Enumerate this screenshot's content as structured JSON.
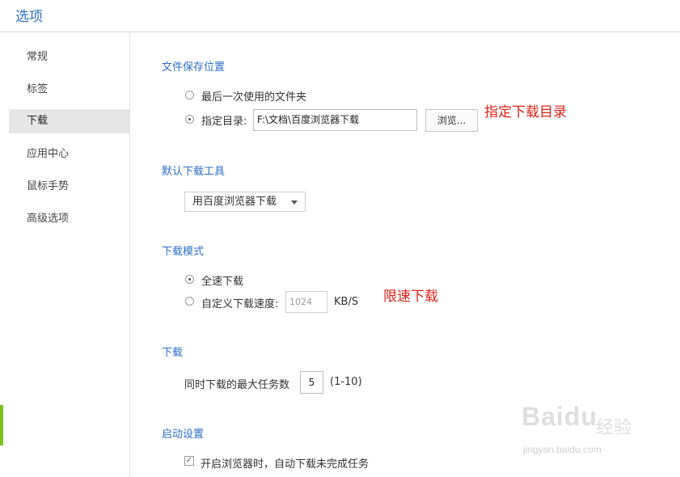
{
  "header": {
    "title": "选项"
  },
  "sidebar": {
    "items": [
      {
        "label": "常规"
      },
      {
        "label": "标签"
      },
      {
        "label": "下载"
      },
      {
        "label": "应用中心"
      },
      {
        "label": "鼠标手势"
      },
      {
        "label": "高级选项"
      }
    ],
    "active_index": 2
  },
  "sections": {
    "save_location": {
      "title": "文件保存位置",
      "option_last_folder": "最后一次使用的文件夹",
      "option_specify": "指定目录:",
      "path_value": "F:\\文档\\百度浏览器下载",
      "browse_label": "浏览...",
      "selected": "specify"
    },
    "default_tool": {
      "title": "默认下载工具",
      "selected_value": "用百度浏览器下载"
    },
    "download_mode": {
      "title": "下载模式",
      "option_full_speed": "全速下载",
      "option_custom": "自定义下载速度:",
      "speed_placeholder": "1024",
      "speed_unit": "KB/S",
      "selected": "full_speed"
    },
    "download": {
      "title": "下载",
      "max_tasks_label": "同时下载的最大任务数",
      "max_tasks_value": "5",
      "max_tasks_range": "(1-10)"
    },
    "startup": {
      "title": "启动设置",
      "auto_resume_label": "开启浏览器时，自动下载未完成任务",
      "auto_resume_checked": true
    }
  },
  "annotations": {
    "specify_dir": "指定下载目录",
    "limit_speed": "限速下载"
  },
  "watermark": {
    "logo": "Baidu",
    "logo_cn": "经验",
    "url": "jingyan.baidu.com"
  },
  "colors": {
    "accent_blue": "#2e6fc7",
    "annotation_red": "#e0211c",
    "active_bar_green": "#7cc11d"
  }
}
